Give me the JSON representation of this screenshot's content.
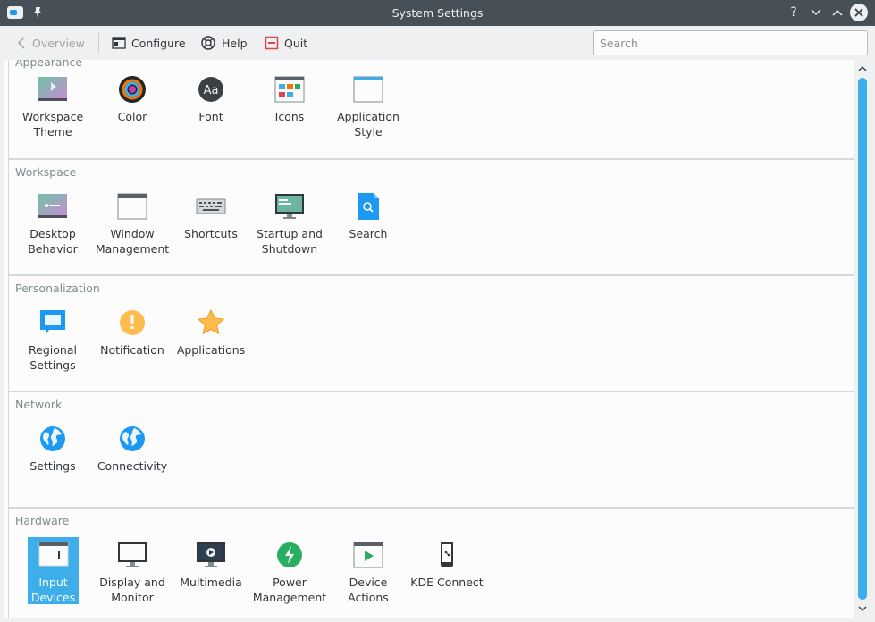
{
  "window": {
    "title": "System Settings"
  },
  "toolbar": {
    "overview_label": "Overview",
    "configure_label": "Configure",
    "help_label": "Help",
    "quit_label": "Quit",
    "search_placeholder": "Search"
  },
  "groups": [
    {
      "title": "Appearance",
      "items": [
        "Workspace Theme",
        "Color",
        "Font",
        "Icons",
        "Application Style"
      ]
    },
    {
      "title": "Workspace",
      "items": [
        "Desktop Behavior",
        "Window Management",
        "Shortcuts",
        "Startup and Shutdown",
        "Search"
      ]
    },
    {
      "title": "Personalization",
      "items": [
        "Regional Settings",
        "Notification",
        "Applications"
      ]
    },
    {
      "title": "Network",
      "items": [
        "Settings",
        "Connectivity"
      ]
    },
    {
      "title": "Hardware",
      "items": [
        "Input Devices",
        "Display and Monitor",
        "Multimedia",
        "Power Management",
        "Device Actions",
        "KDE Connect"
      ]
    }
  ],
  "selected_item": "Input Devices",
  "colors": {
    "accent": "#3daee9",
    "titlebar": "#475057",
    "background": "#eff0f1"
  },
  "icons": [
    "app-icon",
    "pin-icon",
    "help-icon",
    "minimize-icon",
    "maximize-icon",
    "close-icon",
    "back-icon",
    "configure-icon",
    "help-lifebuoy-icon",
    "quit-icon"
  ]
}
